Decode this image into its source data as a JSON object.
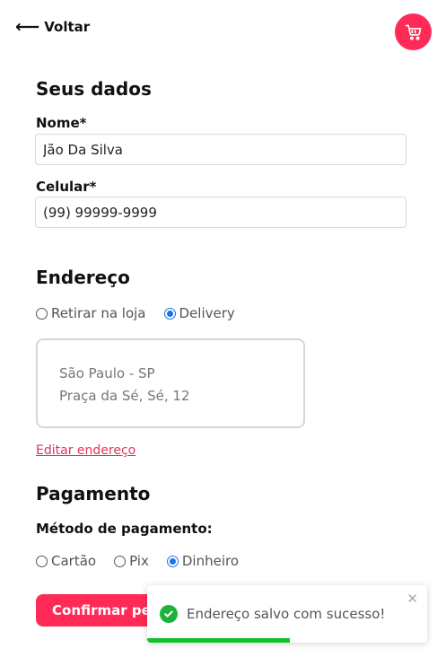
{
  "header": {
    "back_arrow": "⟵",
    "back_label": "Voltar",
    "cart_icon": "shopping-cart-icon"
  },
  "personal": {
    "title": "Seus dados",
    "name_label": "Nome*",
    "name_value": "Jão Da Silva",
    "phone_label": "Celular*",
    "phone_value": "(99) 99999-9999"
  },
  "address": {
    "title": "Endereço",
    "options": [
      {
        "label": "Retirar na loja",
        "checked": false
      },
      {
        "label": "Delivery",
        "checked": true
      }
    ],
    "card_line1": "São Paulo - SP",
    "card_line2": "Praça da Sé, Sé, 12",
    "edit_label": "Editar endereço"
  },
  "payment": {
    "title": "Pagamento",
    "method_label": "Método de pagamento:",
    "options": [
      {
        "label": "Cartão",
        "checked": false
      },
      {
        "label": "Pix",
        "checked": false
      },
      {
        "label": "Dinheiro",
        "checked": true
      }
    ]
  },
  "confirm": {
    "label": "Confirmar pe"
  },
  "toast": {
    "message": "Endereço salvo com sucesso!",
    "close_glyph": "✕",
    "progress": 0.51
  },
  "colors": {
    "accent": "#ff2a55",
    "link": "#e0335c",
    "success": "#1db33a",
    "progress": "#10c128"
  }
}
